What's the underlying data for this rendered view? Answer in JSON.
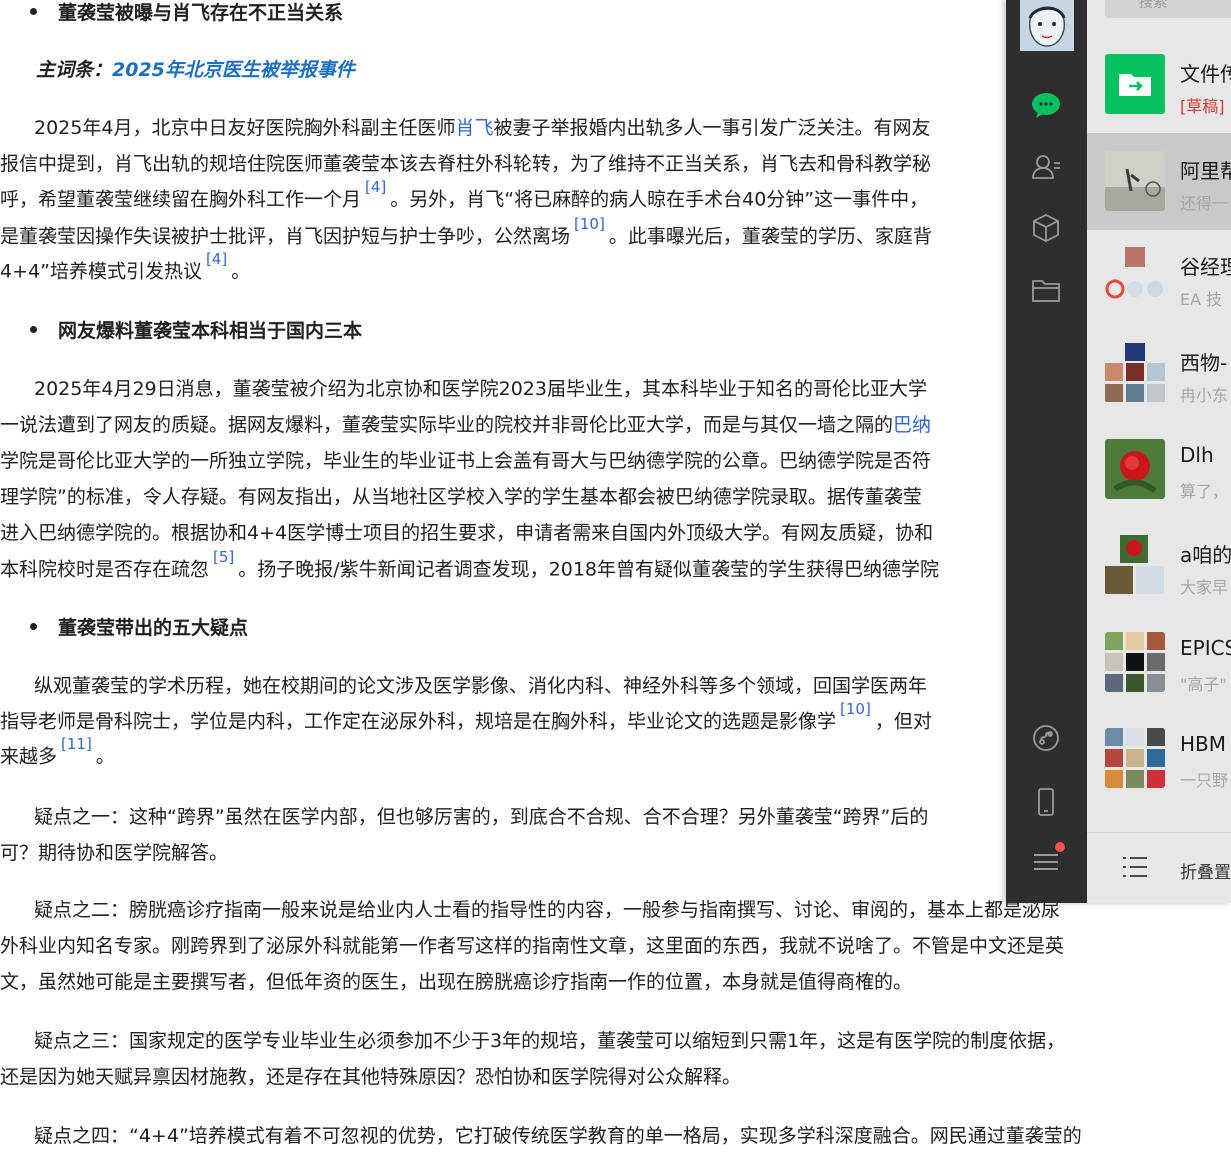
{
  "article": {
    "sections": [
      {
        "heading": "董袭莹被曝与肖飞存在不正当关系",
        "main_word_label": "主词条：",
        "main_word_link": "2025年北京医生被举报事件",
        "lines": [
          {
            "pre": "2025年4月，北京中日友好医院胸外科副主任医师",
            "link": "肖飞",
            "post": "被妻子举报婚内出轨多人一事引发广泛关注。有网友"
          },
          {
            "pre": "报信中提到，肖飞出轨的规培住院医师董袭莹本该去脊柱外科轮转，为了维持不正当关系，肖飞去和骨科教学秘"
          },
          {
            "pre": "呼，希望董袭莹继续留在胸外科工作一个月",
            "ref": "[4]",
            "post": "。另外，肖飞“将已麻醉的病人晾在手术台40分钟”这一事件中，"
          },
          {
            "pre": "是董袭莹因操作失误被护士批评，肖飞因护短与护士争吵，公然离场",
            "ref": "[10]",
            "post": "。此事曝光后，董袭莹的学历、家庭背"
          },
          {
            "pre": "4+4”培养模式引发热议",
            "ref": "[4]",
            "post": "。"
          }
        ]
      },
      {
        "heading": "网友爆料董袭莹本科相当于国内三本",
        "lines": [
          {
            "pre": "2025年4月29日消息，董袭莹被介绍为北京协和医学院2023届毕业生，其本科毕业于知名的哥伦比亚大学"
          },
          {
            "pre": "一说法遭到了网友的质疑。据网友爆料，董袭莹实际毕业的院校并非哥伦比亚大学，而是与其仅一墙之隔的",
            "link": "巴纳"
          },
          {
            "pre": "学院是哥伦比亚大学的一所独立学院，毕业生的毕业证书上会盖有哥大与巴纳德学院的公章。巴纳德学院是否符"
          },
          {
            "pre": "理学院”的标准，令人存疑。有网友指出，从当地社区学校入学的学生基本都会被巴纳德学院录取。据传董袭莹"
          },
          {
            "pre": "进入巴纳德学院的。根据协和4+4医学博士项目的招生要求，申请者需来自国内外顶级大学。有网友质疑，协和"
          },
          {
            "pre": "本科院校时是否存在疏忽",
            "ref": "[5]",
            "post": "。扬子晚报/紫牛新闻记者调查发现，2018年曾有疑似董袭莹的学生获得巴纳德学院"
          }
        ]
      },
      {
        "heading": "董袭莹带出的五大疑点",
        "lines": [
          {
            "pre": "纵观董袭莹的学术历程，她在校期间的论文涉及医学影像、消化内科、神经外科等多个领域，回国学医两年"
          },
          {
            "pre": "指导老师是骨科院士，学位是内科，工作定在泌尿外科，规培是在胸外科，毕业论文的选题是影像学",
            "ref": "[10]",
            "post": "，但对"
          },
          {
            "pre": "来越多",
            "ref": "[11]",
            "post": "。"
          },
          {
            "pre": "疑点之一：这种“跨界”虽然在医学内部，但也够厉害的，到底合不合规、合不合理？另外董袭莹“跨界”后的"
          },
          {
            "pre": "可？期待协和医学院解答。"
          },
          {
            "pre": "疑点之二：膀胱癌诊疗指南一般来说是给业内人士看的指导性的内容，一般参与指南撰写、讨论、审阅的，基本上都是泌尿"
          },
          {
            "pre": "外科业内知名专家。刚跨界到了泌尿外科就能第一作者写这样的指南性文章，这里面的东西，我就不说啥了。不管是中文还是英"
          },
          {
            "pre": "文，虽然她可能是主要撰写者，但低年资的医生，出现在膀胱癌诊疗指南一作的位置，本身就是值得商榷的。"
          },
          {
            "pre": "疑点之三：国家规定的医学专业毕业生必须参加不少于3年的规培，董袭莹可以缩短到只需1年，这是有医学院的制度依据，"
          },
          {
            "pre": "还是因为她天赋异禀因材施教，还是存在其他特殊原因？恐怕协和医学院得对公众解释。"
          },
          {
            "pre": "疑点之四：“4+4”培养模式有着不可忽视的优势，它打破传统医学教育的单一格局，实现多学科深度融合。网民通过董袭莹的"
          }
        ]
      }
    ]
  },
  "wechat": {
    "search_placeholder": "搜索",
    "chats": [
      {
        "name": "文件传",
        "draft": "[草稿]",
        "preview": ""
      },
      {
        "name": "阿里帮",
        "preview": "还得一"
      },
      {
        "name": "谷经理",
        "preview": "EA 技"
      },
      {
        "name": "西物-",
        "preview": "冉小东"
      },
      {
        "name": "Dlh",
        "preview": "算了，"
      },
      {
        "name": "a咱的",
        "preview": "大家早"
      },
      {
        "name": "EPICS",
        "preview": "\"高子\""
      },
      {
        "name": "HBM",
        "preview": "一只野"
      }
    ],
    "footer_label": "折叠置",
    "icons": [
      "chat-icon",
      "contacts-icon",
      "favorites-icon",
      "folder-icon",
      "miniprogram-icon",
      "phone-icon",
      "menu-icon"
    ],
    "colors": {
      "sidebar": "#2e2e2e",
      "accent_green": "#07c160",
      "list_bg": "#e7e7e7",
      "selected_bg": "#c9c9c9",
      "badge_red": "#fa5151"
    }
  }
}
